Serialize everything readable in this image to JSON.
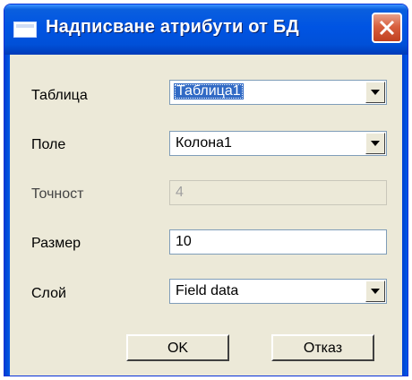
{
  "window": {
    "title": "Надписване атрибути от БД"
  },
  "form": {
    "table": {
      "label": "Таблица",
      "value": "Таблица1"
    },
    "field": {
      "label": "Поле",
      "value": "Колона1"
    },
    "precision": {
      "label": "Точност",
      "value": "4"
    },
    "size": {
      "label": "Размер",
      "value": "10"
    },
    "layer": {
      "label": "Слой",
      "value": "Field data"
    }
  },
  "buttons": {
    "ok": "OK",
    "cancel": "Отказ"
  },
  "icons": {
    "close": "close-icon",
    "app": "window-icon",
    "dropdown": "chevron-down-icon"
  }
}
